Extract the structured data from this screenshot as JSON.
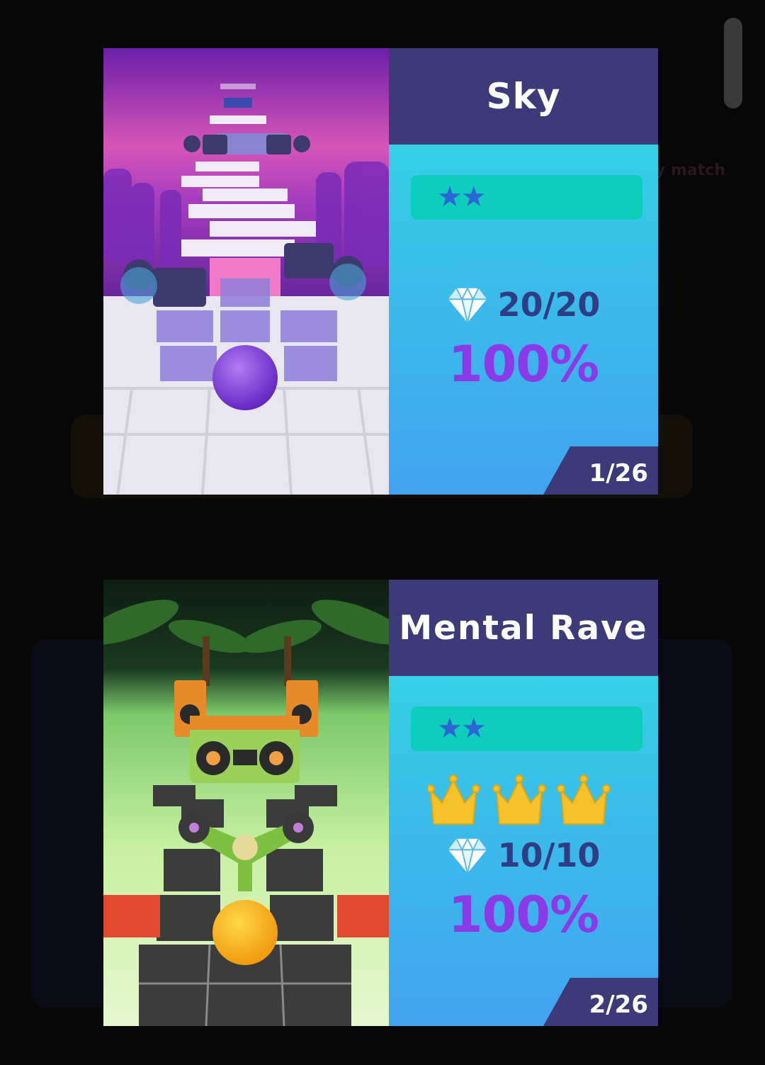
{
  "levels": [
    {
      "title": "Sky",
      "stars": "★★",
      "crowns": null,
      "gems": "20/20",
      "percent": "100%",
      "level": "1/26"
    },
    {
      "title": "Mental Rave",
      "stars": "★★",
      "crowns": 3,
      "gems": "10/10",
      "percent": "100%",
      "level": "2/26"
    }
  ],
  "background": {
    "ghost_text": "y match"
  },
  "colors": {
    "title_bar": "#3c3a78",
    "stars_bar": "#0fcdbc",
    "star": "#2b67d4",
    "percent": "#8a3ae6",
    "gem_count": "#2f3e84",
    "crown": "#f5c22a"
  }
}
